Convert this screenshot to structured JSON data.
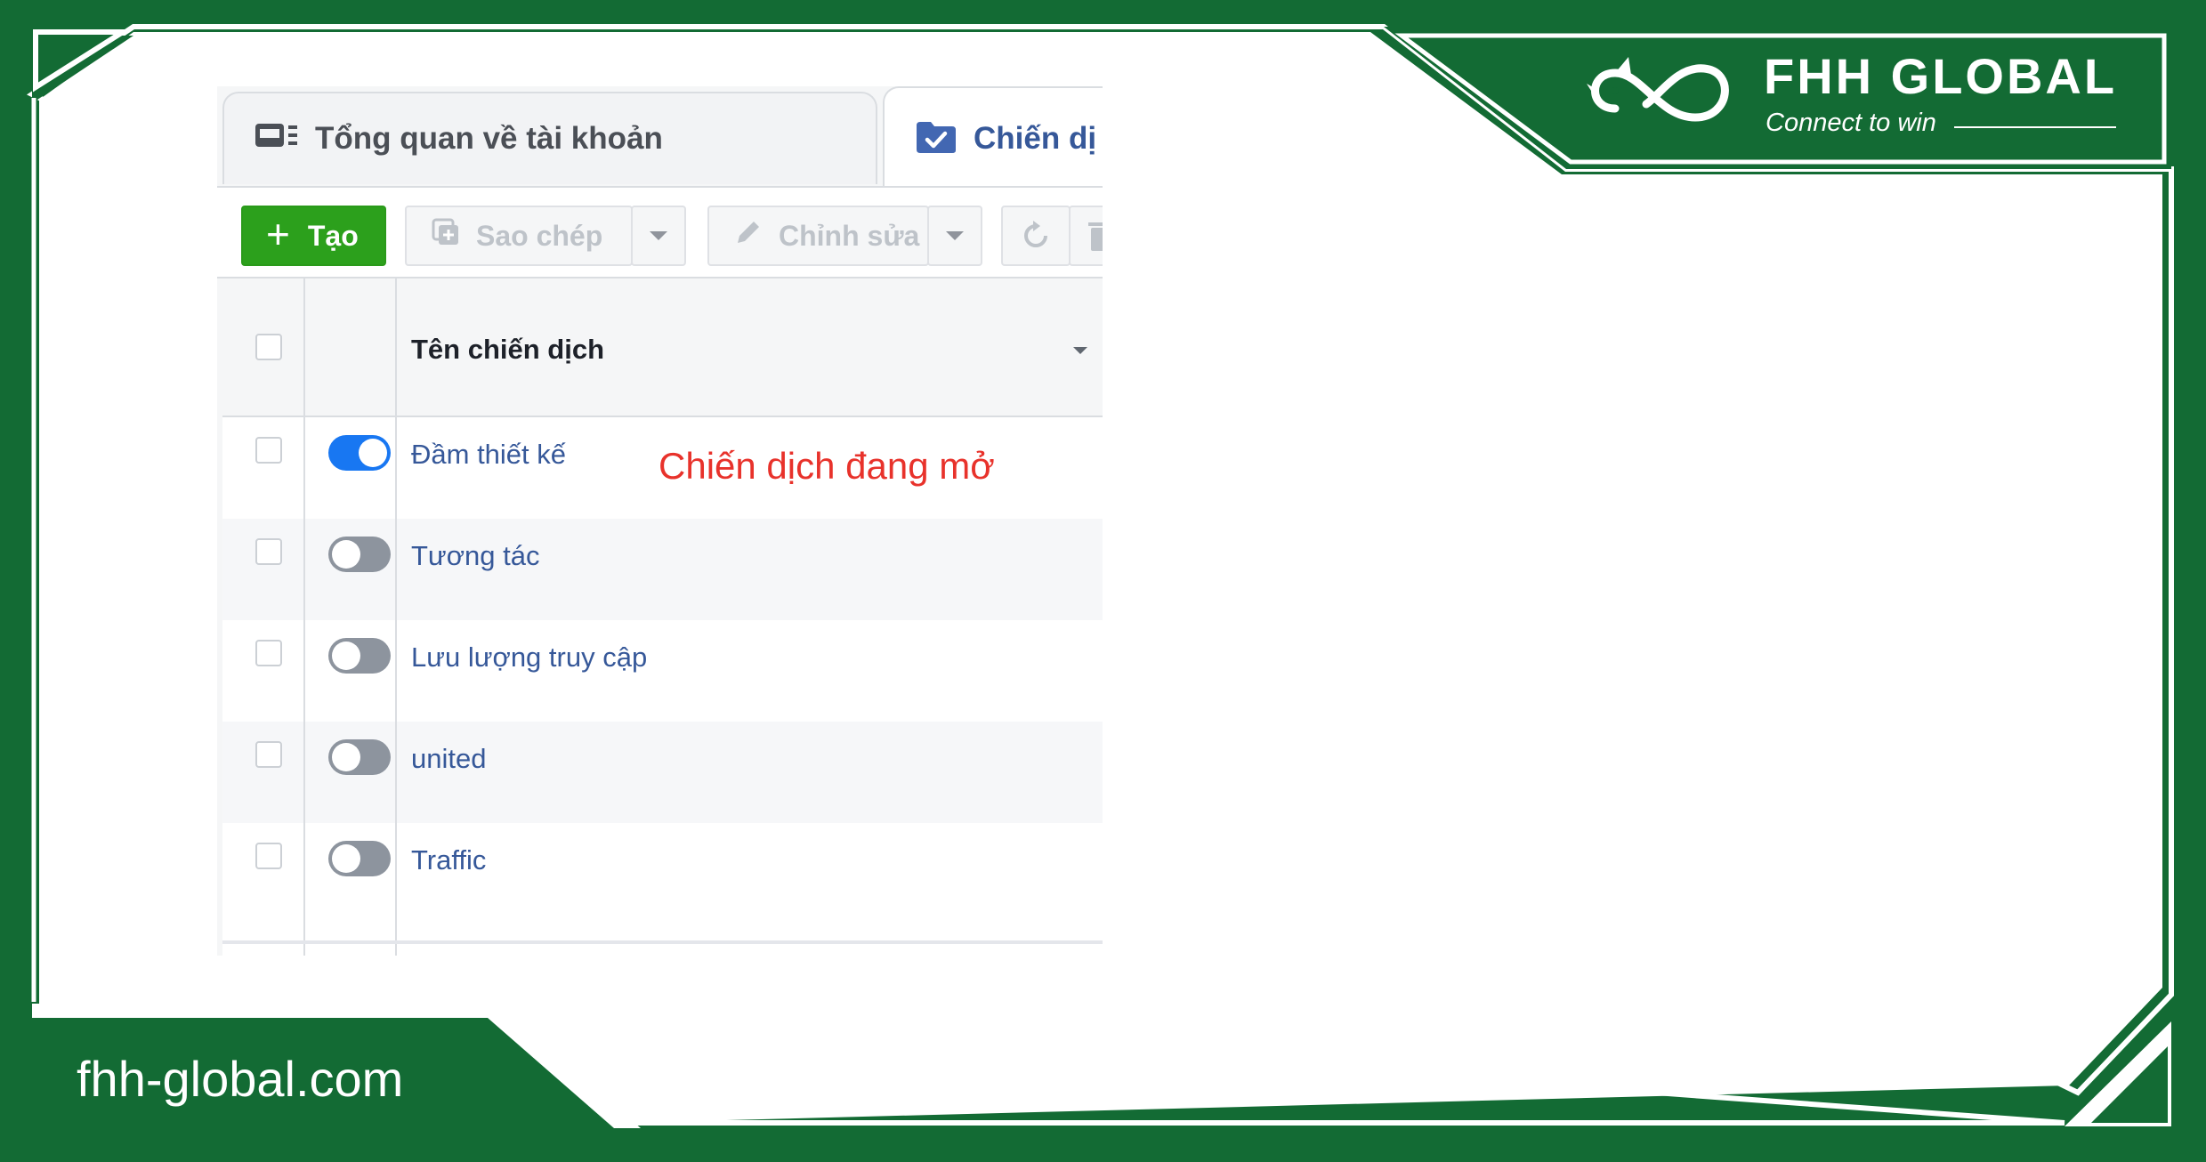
{
  "brand": {
    "name": "FHH GLOBAL",
    "tagline": "Connect to win",
    "website": "fhh-global.com",
    "colors": {
      "primary_green": "#136b34",
      "white": "#ffffff"
    }
  },
  "ads_manager": {
    "tabs": [
      {
        "label": "Tổng quan về tài khoản",
        "icon": "account-overview-icon",
        "active": false
      },
      {
        "label": "Chiến dị",
        "icon": "campaign-folder-icon",
        "active": true
      }
    ],
    "toolbar": {
      "create_label": "Tạo",
      "copy_label": "Sao chép",
      "edit_label": "Chỉnh sửa"
    },
    "table": {
      "column_header": "Tên chiến dịch",
      "rows": [
        {
          "name": "Đầm thiết kế",
          "active": true
        },
        {
          "name": "Tương tác",
          "active": false
        },
        {
          "name": "Lưu lượng truy cập",
          "active": false
        },
        {
          "name": "united",
          "active": false
        },
        {
          "name": "Traffic",
          "active": false
        }
      ]
    },
    "annotation": "Chiến dịch đang mở",
    "colors": {
      "create_green": "#2ca01c",
      "toggle_on": "#1877f2",
      "toggle_off": "#8d949e",
      "link_blue": "#365899",
      "annotation_red": "#e8322b"
    }
  }
}
